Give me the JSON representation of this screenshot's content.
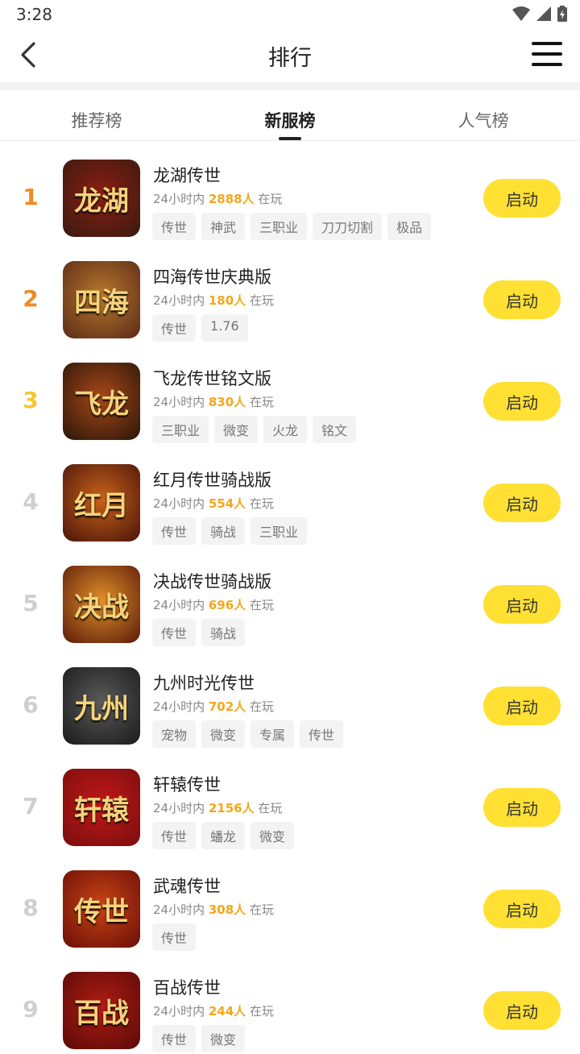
{
  "status": {
    "time": "3:28"
  },
  "header": {
    "title": "排行"
  },
  "tabs": [
    {
      "label": "推荐榜"
    },
    {
      "label": "新服榜"
    },
    {
      "label": "人气榜"
    }
  ],
  "active_tab": "新服榜",
  "meta_prefix": "24小时内",
  "meta_suffix": "在玩",
  "games": [
    {
      "rank": "1",
      "name": "龙湖传世",
      "count": "2888人",
      "tags": [
        "传世",
        "神武",
        "三职业",
        "刀刀切割",
        "极品"
      ],
      "button": "启动",
      "icon_text": "龙湖",
      "icon_colors": [
        "#3a1a10",
        "#8a1e12"
      ],
      "rank_color": "#f08a24"
    },
    {
      "rank": "2",
      "name": "四海传世庆典版",
      "count": "180人",
      "tags": [
        "传世",
        "1.76"
      ],
      "button": "启动",
      "icon_text": "四海",
      "icon_colors": [
        "#5a2a18",
        "#b8782c"
      ],
      "rank_color": "#f08a24"
    },
    {
      "rank": "3",
      "name": "飞龙传世铭文版",
      "count": "830人",
      "tags": [
        "三职业",
        "微变",
        "火龙",
        "铭文"
      ],
      "button": "启动",
      "icon_text": "飞龙",
      "icon_colors": [
        "#2a1608",
        "#a8481a"
      ],
      "rank_color": "#f5c534"
    },
    {
      "rank": "4",
      "name": "红月传世骑战版",
      "count": "554人",
      "tags": [
        "传世",
        "骑战",
        "三职业"
      ],
      "button": "启动",
      "icon_text": "红月",
      "icon_colors": [
        "#4a1408",
        "#c8621c"
      ],
      "rank_color": "#cfcfcf"
    },
    {
      "rank": "5",
      "name": "决战传世骑战版",
      "count": "696人",
      "tags": [
        "传世",
        "骑战"
      ],
      "button": "启动",
      "icon_text": "决战",
      "icon_colors": [
        "#5a1a08",
        "#e0902a"
      ],
      "rank_color": "#cfcfcf"
    },
    {
      "rank": "6",
      "name": "九州时光传世",
      "count": "702人",
      "tags": [
        "宠物",
        "微变",
        "专属",
        "传世"
      ],
      "button": "启动",
      "icon_text": "九州",
      "icon_colors": [
        "#1a1a1a",
        "#5a5a5a"
      ],
      "rank_color": "#cfcfcf"
    },
    {
      "rank": "7",
      "name": "轩辕传世",
      "count": "2156人",
      "tags": [
        "传世",
        "蟠龙",
        "微变"
      ],
      "button": "启动",
      "icon_text": "轩辕",
      "icon_colors": [
        "#7a0e0e",
        "#c01818"
      ],
      "rank_color": "#cfcfcf"
    },
    {
      "rank": "8",
      "name": "武魂传世",
      "count": "308人",
      "tags": [
        "传世"
      ],
      "button": "启动",
      "icon_text": "传世",
      "icon_colors": [
        "#6a0e08",
        "#c84414"
      ],
      "rank_color": "#cfcfcf"
    },
    {
      "rank": "9",
      "name": "百战传世",
      "count": "244人",
      "tags": [
        "传世",
        "微变"
      ],
      "button": "启动",
      "icon_text": "百战",
      "icon_colors": [
        "#5a0a08",
        "#b01c14"
      ],
      "rank_color": "#cfcfcf"
    }
  ],
  "colors": {
    "accent_button": "#ffe033",
    "count_highlight": "#f4a71a"
  }
}
